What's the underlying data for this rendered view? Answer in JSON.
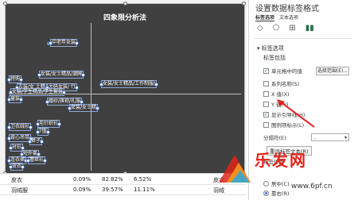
{
  "chart": {
    "title": "四象限分析法",
    "labels": [
      {
        "text": "中老年女装"
      },
      {
        "text": "女装/女士精品/潮牌"
      },
      {
        "text": "女装/女士精品/工作制服/"
      },
      {
        "text": "特购"
      },
      {
        "text": "古装/女 士精"
      },
      {
        "text": "大码女装/ 行"
      },
      {
        "text": "女装/学生精品/学生套装"
      },
      {
        "text": "童装"
      },
      {
        "text": "婚纱/旗袍/礼服"
      },
      {
        "text": "女装/女士精"
      },
      {
        "text": "卫衣绒衫"
      },
      {
        "text": "毛针织衫"
      },
      {
        "text": "T恤"
      },
      {
        "text": "背心吊带"
      },
      {
        "text": "裤子"
      },
      {
        "text": "衬衫"
      },
      {
        "text": "短外套"
      },
      {
        "text": "连衣裙"
      },
      {
        "text": "蕾丝衫"
      },
      {
        "text": "皮衣"
      }
    ]
  },
  "sheet": {
    "rows": [
      {
        "name": "皮衣",
        "c1": "0.09%",
        "c2": "82.82%",
        "c3": "6.52%",
        "c4": "皮衣"
      },
      {
        "name": "羽绒服",
        "c1": "0.09%",
        "c2": "39.57%",
        "c3": "11.11%",
        "c4": "羽绒"
      }
    ]
  },
  "panel": {
    "title": "设置数据标签格式",
    "tab_label_options": "标签选项",
    "tab_text_options": "文本选项",
    "section": "标签选项",
    "subsection": "标签包括",
    "options": [
      {
        "label": "单元格中的值",
        "checked": true
      },
      {
        "label": "系列名称(S)",
        "checked": false
      },
      {
        "label": "X 值(X)",
        "checked": false
      },
      {
        "label": "Y 值(Y)",
        "checked": false
      },
      {
        "label": "显示引导线(H)",
        "checked": true
      },
      {
        "label": "图例项标示(L)",
        "checked": false
      }
    ],
    "select_range_button": "选择范围(E)...",
    "separator_label": "分隔符(E)",
    "separator_value": ",",
    "reset_label": "重设标签文本(R)",
    "position_label": "标签位置",
    "position_options": [
      {
        "label": "居中(C)",
        "selected": false
      },
      {
        "label": "靠右(R)",
        "selected": true
      }
    ]
  },
  "watermark": {
    "text": "乐发网",
    "url": "www.6pf.cn"
  }
}
